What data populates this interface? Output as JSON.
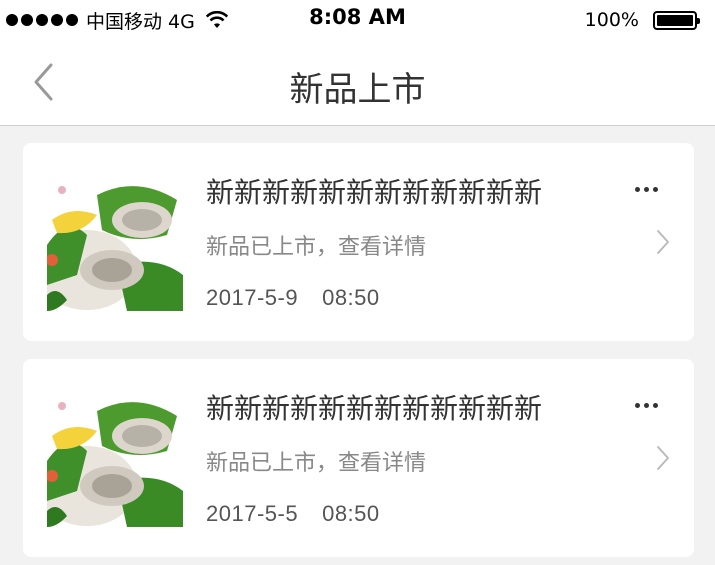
{
  "status_bar": {
    "carrier": "中国移动 4G",
    "time": "8:08 AM",
    "battery": "100%",
    "icons": [
      "signal-dots-icon",
      "wifi-icon",
      "battery-icon"
    ]
  },
  "nav": {
    "title": "新品上市",
    "back_icon": "chevron-left-icon"
  },
  "cards": [
    {
      "title": "新新新新新新新新新新新新",
      "desc": "新品已上市，查看详情",
      "date": "2017-5-9",
      "time": "08:50",
      "image": "oyster-plate-thumbnail",
      "more_icon": "ellipsis-icon",
      "arrow_icon": "chevron-right-icon"
    },
    {
      "title": "新新新新新新新新新新新新",
      "desc": "新品已上市，查看详情",
      "date": "2017-5-5",
      "time": "08:50",
      "image": "oyster-plate-thumbnail",
      "more_icon": "ellipsis-icon",
      "arrow_icon": "chevron-right-icon"
    }
  ],
  "colors": {
    "background": "#f2f2f2",
    "card": "#ffffff",
    "title_text": "#333333",
    "secondary_text": "#888888"
  }
}
